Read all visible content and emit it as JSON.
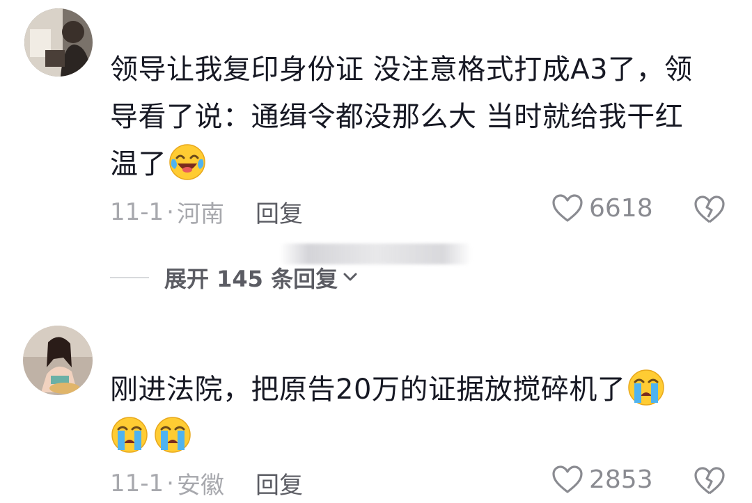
{
  "comments": [
    {
      "text_lines": [
        "领导让我复印身份证 没注意格式打成A3了，领",
        "导看了说：通缉令都没那么大 当时就给我干红",
        "温了"
      ],
      "emoji_name": "laugh-cry-emoji",
      "date": "11-1",
      "location": "河南",
      "reply_label": "回复",
      "likes": "6618",
      "expand_label": "展开 145 条回复"
    },
    {
      "text_lines": [
        "刚进法院，把原告20万的证据放搅碎机了"
      ],
      "emoji_name": "loudly-crying-emoji",
      "date": "11-1",
      "location": "安徽",
      "reply_label": "回复",
      "likes": "2853"
    }
  ],
  "separator": "·",
  "colors": {
    "text": "#161823",
    "meta": "#a7a8ad",
    "action": "#5b5c63"
  }
}
